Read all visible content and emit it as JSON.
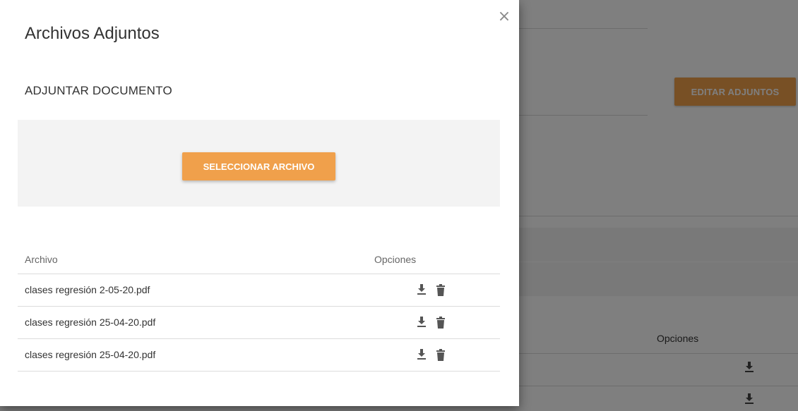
{
  "modal": {
    "title": "Archivos Adjuntos",
    "close_label": "×",
    "section_title": "ADJUNTAR DOCUMENTO",
    "select_button_label": "SELECCIONAR ARCHIVO",
    "table": {
      "columns": [
        "Archivo",
        "Opciones"
      ],
      "rows": [
        {
          "filename": "clases regresión 2-05-20.pdf",
          "actions": [
            "download-icon",
            "trash-icon"
          ]
        },
        {
          "filename": "clases regresión 25-04-20.pdf",
          "actions": [
            "download-icon",
            "trash-icon"
          ]
        },
        {
          "filename": "clases regresión 25-04-20.pdf",
          "actions": [
            "download-icon",
            "trash-icon"
          ]
        }
      ]
    }
  },
  "background": {
    "edit_button_label": "EDITAR ADJUNTOS",
    "options_header": "Opciones"
  },
  "colors": {
    "accent_button": "#f0a04b",
    "overlay": "rgba(0,0,0,0.5)",
    "icon": "#555555"
  }
}
